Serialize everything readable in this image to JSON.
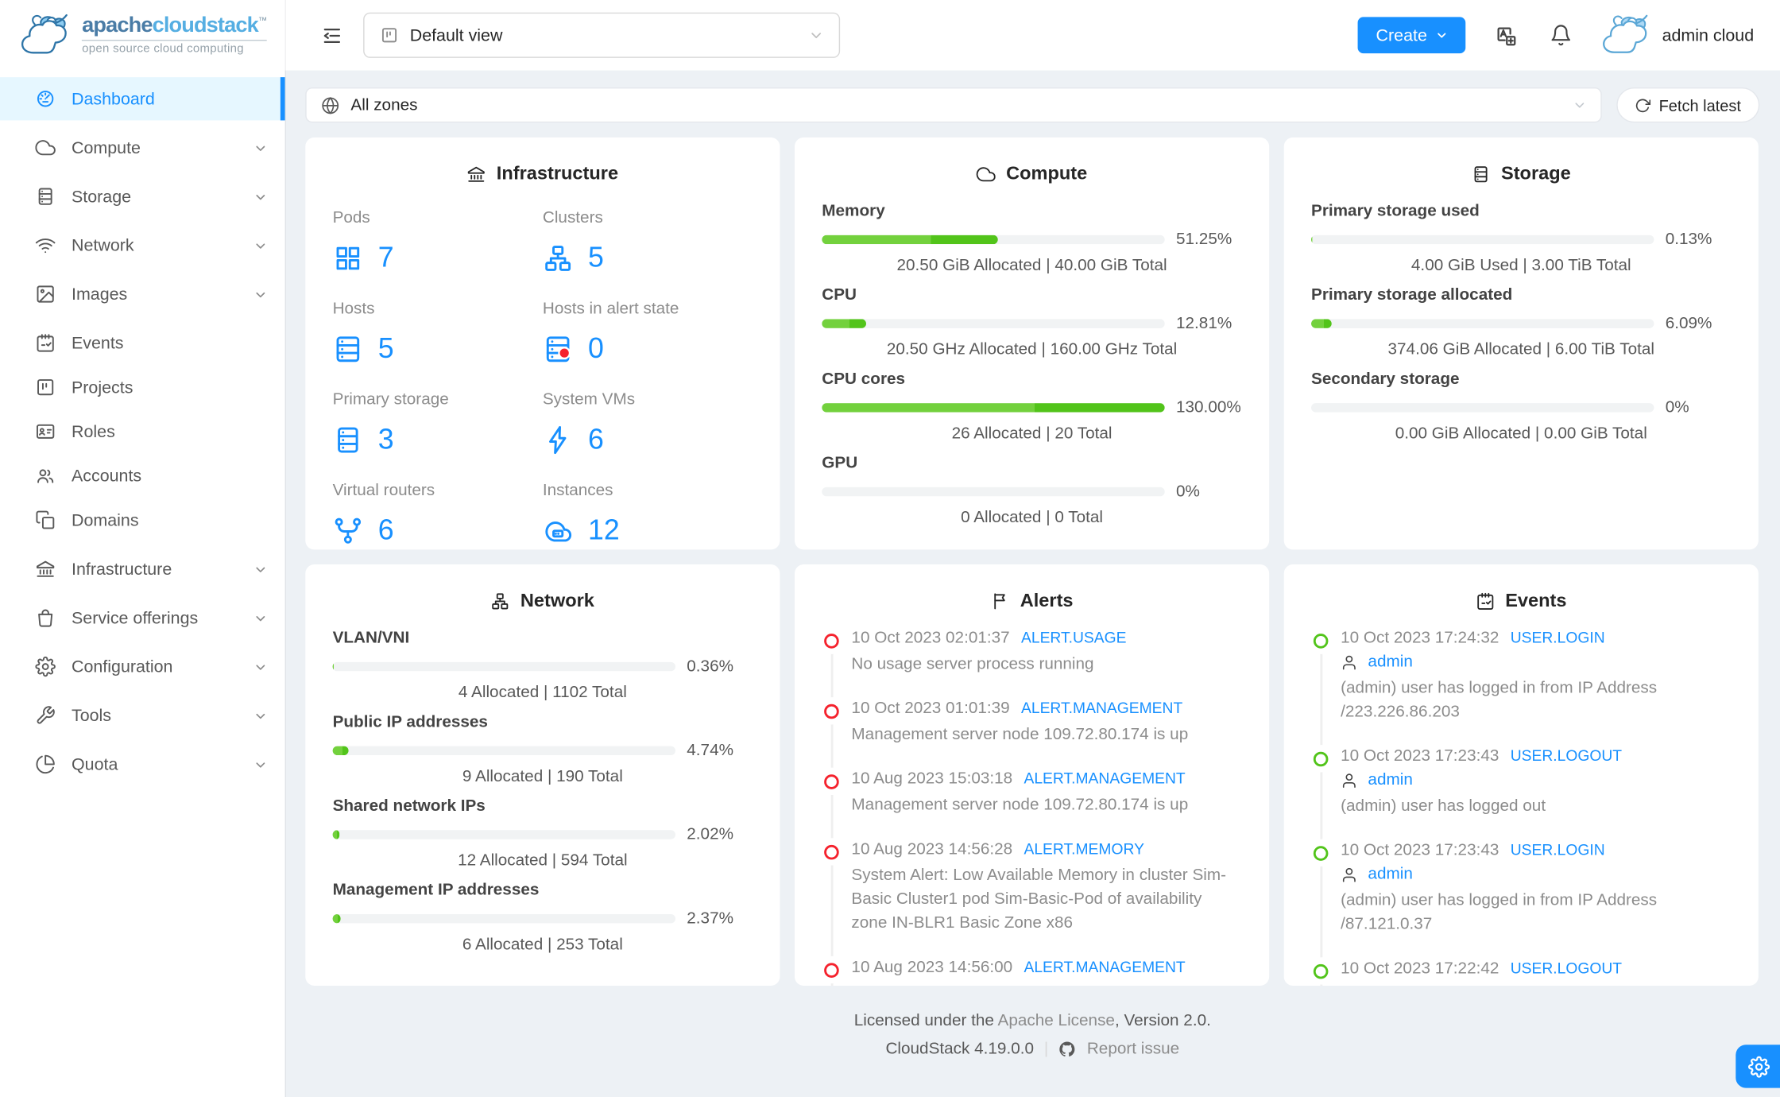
{
  "colors": {
    "accent": "#1890ff",
    "green": "#52c41a",
    "green_light": "#73d13d",
    "red": "#f5222d"
  },
  "header": {
    "logo": {
      "brand_bold": "apache",
      "brand_light": "cloudstack",
      "trademark": "TM",
      "tagline": "open source cloud computing"
    },
    "view_select": {
      "value": "Default view"
    },
    "create_button": {
      "label": "Create"
    },
    "user": {
      "name": "admin cloud"
    }
  },
  "sidebar": {
    "items": [
      {
        "id": "dashboard",
        "label": "Dashboard",
        "icon": "dashboard-icon",
        "active": true,
        "group": false
      },
      {
        "id": "compute",
        "label": "Compute",
        "icon": "cloud-icon",
        "active": false,
        "group": true
      },
      {
        "id": "storage",
        "label": "Storage",
        "icon": "storage-rack-icon",
        "active": false,
        "group": true
      },
      {
        "id": "network",
        "label": "Network",
        "icon": "wifi-icon",
        "active": false,
        "group": true
      },
      {
        "id": "images",
        "label": "Images",
        "icon": "picture-icon",
        "active": false,
        "group": true
      },
      {
        "id": "events",
        "label": "Events",
        "icon": "calendar-check-icon",
        "active": false,
        "group": false
      },
      {
        "id": "projects",
        "label": "Projects",
        "icon": "project-icon",
        "active": false,
        "group": false
      },
      {
        "id": "roles",
        "label": "Roles",
        "icon": "idcard-icon",
        "active": false,
        "group": false
      },
      {
        "id": "accounts",
        "label": "Accounts",
        "icon": "team-icon",
        "active": false,
        "group": false
      },
      {
        "id": "domains",
        "label": "Domains",
        "icon": "copy-icon",
        "active": false,
        "group": false
      },
      {
        "id": "infrastructure",
        "label": "Infrastructure",
        "icon": "bank-icon",
        "active": false,
        "group": true
      },
      {
        "id": "service-offerings",
        "label": "Service offerings",
        "icon": "shopping-bag-icon",
        "active": false,
        "group": true
      },
      {
        "id": "configuration",
        "label": "Configuration",
        "icon": "gear-icon",
        "active": false,
        "group": true
      },
      {
        "id": "tools",
        "label": "Tools",
        "icon": "wrench-icon",
        "active": false,
        "group": true
      },
      {
        "id": "quota",
        "label": "Quota",
        "icon": "pie-chart-icon",
        "active": false,
        "group": true
      }
    ]
  },
  "zonebar": {
    "zone_select": {
      "value": "All zones"
    },
    "fetch_button": {
      "label": "Fetch latest"
    }
  },
  "cards": {
    "infrastructure": {
      "title": "Infrastructure",
      "stats": [
        {
          "label": "Pods",
          "value": "7",
          "icon": "pods-icon"
        },
        {
          "label": "Clusters",
          "value": "5",
          "icon": "cluster-icon"
        },
        {
          "label": "Hosts",
          "value": "5",
          "icon": "host-icon"
        },
        {
          "label": "Hosts in alert state",
          "value": "0",
          "icon": "host-alert-icon"
        },
        {
          "label": "Primary storage",
          "value": "3",
          "icon": "storage-rack-icon"
        },
        {
          "label": "System VMs",
          "value": "6",
          "icon": "thunderbolt-icon"
        },
        {
          "label": "Virtual routers",
          "value": "6",
          "icon": "fork-icon"
        },
        {
          "label": "Instances",
          "value": "12",
          "icon": "cloud-server-icon"
        }
      ]
    },
    "compute": {
      "title": "Compute",
      "sections": [
        {
          "label": "Memory",
          "percent": 51.25,
          "percent_label": "51.25%",
          "detail": "20.50 GiB Allocated | 40.00 GiB Total"
        },
        {
          "label": "CPU",
          "percent": 12.81,
          "percent_label": "12.81%",
          "detail": "20.50 GHz Allocated | 160.00 GHz Total"
        },
        {
          "label": "CPU cores",
          "percent": 130,
          "percent_label": "130.00%",
          "detail": "26 Allocated | 20 Total"
        },
        {
          "label": "GPU",
          "percent": 0,
          "percent_label": "0%",
          "detail": "0 Allocated | 0 Total"
        }
      ]
    },
    "storage": {
      "title": "Storage",
      "sections": [
        {
          "label": "Primary storage used",
          "percent": 0.13,
          "percent_label": "0.13%",
          "detail": "4.00 GiB Used | 3.00 TiB Total"
        },
        {
          "label": "Primary storage allocated",
          "percent": 6.09,
          "percent_label": "6.09%",
          "detail": "374.06 GiB Allocated | 6.00 TiB Total"
        },
        {
          "label": "Secondary storage",
          "percent": 0,
          "percent_label": "0%",
          "detail": "0.00 GiB Allocated | 0.00 GiB Total"
        }
      ]
    },
    "network": {
      "title": "Network",
      "sections": [
        {
          "label": "VLAN/VNI",
          "percent": 0.36,
          "percent_label": "0.36%",
          "detail": "4 Allocated | 1102 Total"
        },
        {
          "label": "Public IP addresses",
          "percent": 4.74,
          "percent_label": "4.74%",
          "detail": "9 Allocated | 190 Total"
        },
        {
          "label": "Shared network IPs",
          "percent": 2.02,
          "percent_label": "2.02%",
          "detail": "12 Allocated | 594 Total"
        },
        {
          "label": "Management IP addresses",
          "percent": 2.37,
          "percent_label": "2.37%",
          "detail": "6 Allocated | 253 Total"
        }
      ]
    },
    "alerts": {
      "title": "Alerts",
      "items": [
        {
          "time": "10 Oct 2023 02:01:37",
          "tag": "ALERT.USAGE",
          "desc": "No usage server process running"
        },
        {
          "time": "10 Oct 2023 01:01:39",
          "tag": "ALERT.MANAGEMENT",
          "desc": "Management server node 109.72.80.174 is up"
        },
        {
          "time": "10 Aug 2023 15:03:18",
          "tag": "ALERT.MANAGEMENT",
          "desc": "Management server node 109.72.80.174 is up"
        },
        {
          "time": "10 Aug 2023 14:56:28",
          "tag": "ALERT.MEMORY",
          "desc": "System Alert: Low Available Memory in cluster Sim-Basic Cluster1 pod Sim-Basic-Pod of availability zone IN-BLR1 Basic Zone x86"
        },
        {
          "time": "10 Aug 2023 14:56:00",
          "tag": "ALERT.MANAGEMENT",
          "desc": ""
        }
      ]
    },
    "events": {
      "title": "Events",
      "items": [
        {
          "time": "10 Oct 2023 17:24:32",
          "tag": "USER.LOGIN",
          "user": "admin",
          "desc": "(admin) user has logged in from IP Address /223.226.86.203"
        },
        {
          "time": "10 Oct 2023 17:23:43",
          "tag": "USER.LOGOUT",
          "user": "admin",
          "desc": "(admin) user has logged out"
        },
        {
          "time": "10 Oct 2023 17:23:43",
          "tag": "USER.LOGIN",
          "user": "admin",
          "desc": "(admin) user has logged in from IP Address /87.121.0.37"
        },
        {
          "time": "10 Oct 2023 17:22:42",
          "tag": "USER.LOGOUT",
          "user": "",
          "desc": ""
        }
      ]
    }
  },
  "footer": {
    "license_prefix": "Licensed under the ",
    "license_link": "Apache License",
    "license_suffix": ", Version 2.0.",
    "version": "CloudStack 4.19.0.0",
    "report_issue": "Report issue"
  }
}
